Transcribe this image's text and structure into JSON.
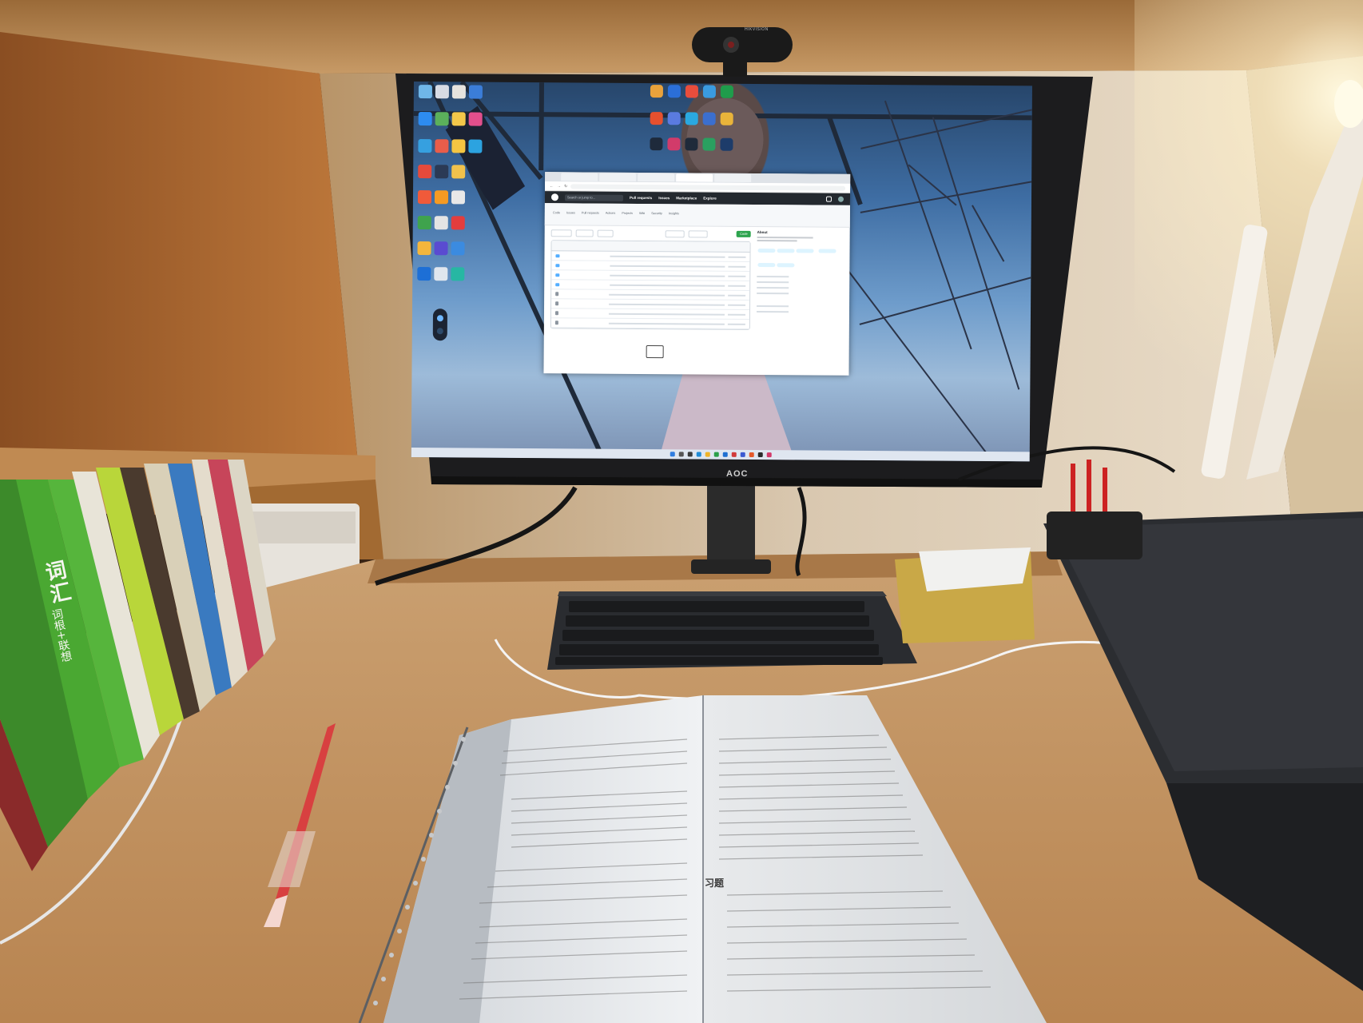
{
  "scene": {
    "description_free": true,
    "monitor": {
      "brand_label": "AOC",
      "webcam_label": "HIKVISION",
      "browser": {
        "tabs": [
          "",
          "",
          "",
          "",
          ""
        ],
        "github_nav": {
          "search_placeholder": "Search or jump to...",
          "links": [
            "Pull requests",
            "Issues",
            "Marketplace",
            "Explore"
          ]
        },
        "repo_title": "",
        "repo_tabs": [
          "Code",
          "Issues",
          "Pull requests",
          "Actions",
          "Projects",
          "Wiki",
          "Security",
          "Insights"
        ],
        "code_button": "Code",
        "about_heading": "About"
      }
    },
    "book": {
      "left_heading": "",
      "right_heading": "",
      "exercise_heading": "习题"
    },
    "vocab_book": {
      "spine_text": "词汇",
      "spine_subtext": "词根+联想"
    },
    "colors": {
      "desk": "#c99a63",
      "cabinet": "#b5763b",
      "github_header": "#24292f",
      "github_green": "#2da44e"
    }
  }
}
